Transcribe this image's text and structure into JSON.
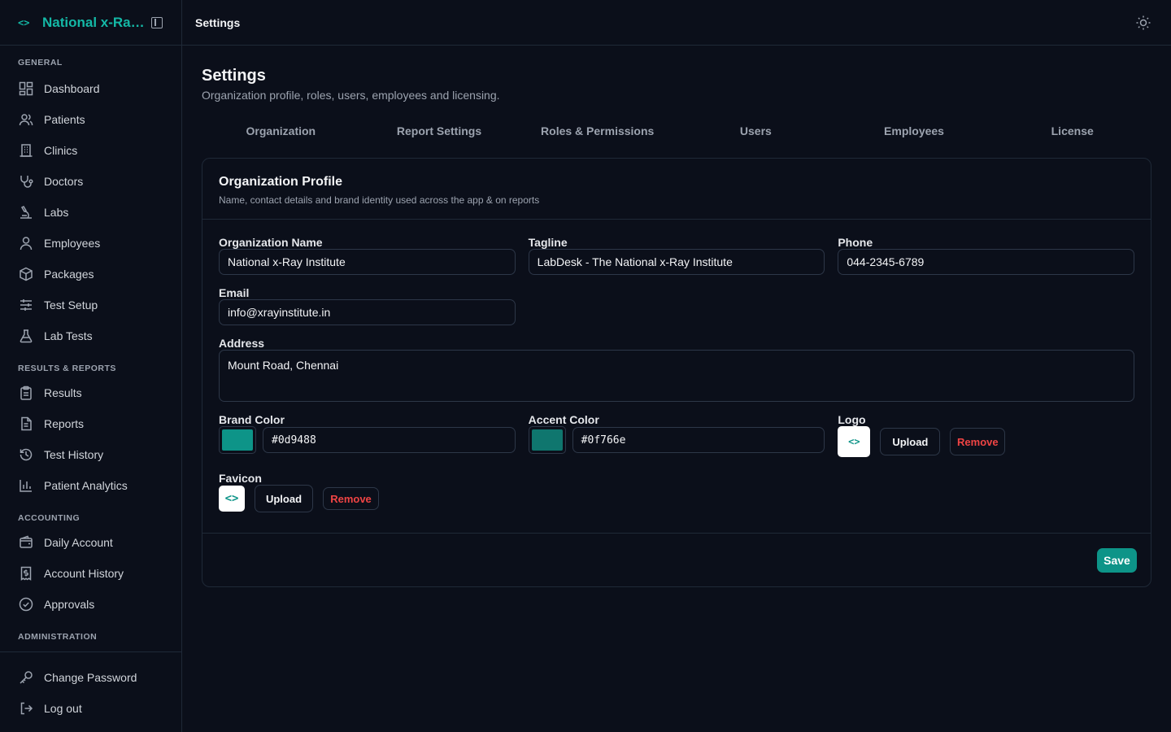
{
  "brand": {
    "name": "National x-Ray Institute",
    "logo": "<>"
  },
  "sidebar": {
    "sections": {
      "general": "GENERAL",
      "results": "RESULTS & REPORTS",
      "accounting": "ACCOUNTING",
      "administration": "ADMINISTRATION"
    },
    "items": {
      "dashboard": "Dashboard",
      "patients": "Patients",
      "clinics": "Clinics",
      "doctors": "Doctors",
      "labs": "Labs",
      "employees": "Employees",
      "packages": "Packages",
      "test_setup": "Test Setup",
      "lab_tests": "Lab Tests",
      "results": "Results",
      "reports": "Reports",
      "test_history": "Test History",
      "patient_analytics": "Patient Analytics",
      "daily_account": "Daily Account",
      "account_history": "Account History",
      "approvals": "Approvals",
      "change_password": "Change Password",
      "log_out": "Log out"
    }
  },
  "topbar": {
    "title": "Settings"
  },
  "page": {
    "title": "Settings",
    "subtitle": "Organization profile, roles, users, employees and licensing."
  },
  "tabs": {
    "organization": "Organization",
    "report_settings": "Report Settings",
    "roles": "Roles & Permissions",
    "users": "Users",
    "employees": "Employees",
    "license": "License"
  },
  "card": {
    "title": "Organization Profile",
    "subtitle": "Name, contact details and brand identity used across the app & on reports"
  },
  "form": {
    "org_name_label": "Organization Name",
    "org_name": "National x-Ray Institute",
    "tagline_label": "Tagline",
    "tagline": "LabDesk - The National x-Ray Institute",
    "phone_label": "Phone",
    "phone": "044-2345-6789",
    "email_label": "Email",
    "email": "info@xrayinstitute.in",
    "address_label": "Address",
    "address": "Mount Road, Chennai",
    "brand_color_label": "Brand Color",
    "brand_color": "#0d9488",
    "accent_color_label": "Accent Color",
    "accent_color": "#0f766e",
    "logo_label": "Logo",
    "favicon_label": "Favicon",
    "upload": "Upload",
    "remove": "Remove",
    "save": "Save"
  },
  "colors": {
    "accent": "#14b8a6",
    "brand": "#0d9488",
    "accent_color": "#0f766e",
    "danger": "#ef4444"
  }
}
